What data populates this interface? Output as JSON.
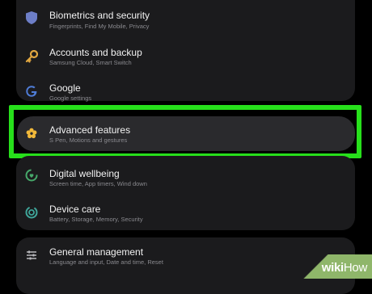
{
  "settings": {
    "items": [
      {
        "title": "Biometrics and security",
        "subtitle": "Fingerprints, Find My Mobile, Privacy",
        "icon": "shield-icon"
      },
      {
        "title": "Accounts and backup",
        "subtitle": "Samsung Cloud, Smart Switch",
        "icon": "key-icon"
      },
      {
        "title": "Google",
        "subtitle": "Google settings",
        "icon": "google-icon"
      },
      {
        "title": "Advanced features",
        "subtitle": "S Pen, Motions and gestures",
        "icon": "gear-flower-icon"
      },
      {
        "title": "Digital wellbeing",
        "subtitle": "Screen time, App timers, Wind down",
        "icon": "wellbeing-icon"
      },
      {
        "title": "Device care",
        "subtitle": "Battery, Storage, Memory, Security",
        "icon": "device-care-icon"
      },
      {
        "title": "General management",
        "subtitle": "Language and input, Date and time, Reset",
        "icon": "sliders-icon"
      }
    ]
  },
  "colors": {
    "highlight": "#27e01b",
    "background": "#000000",
    "card": "#1b1b1d"
  },
  "watermark": {
    "bold": "wiki",
    "light": "How"
  }
}
